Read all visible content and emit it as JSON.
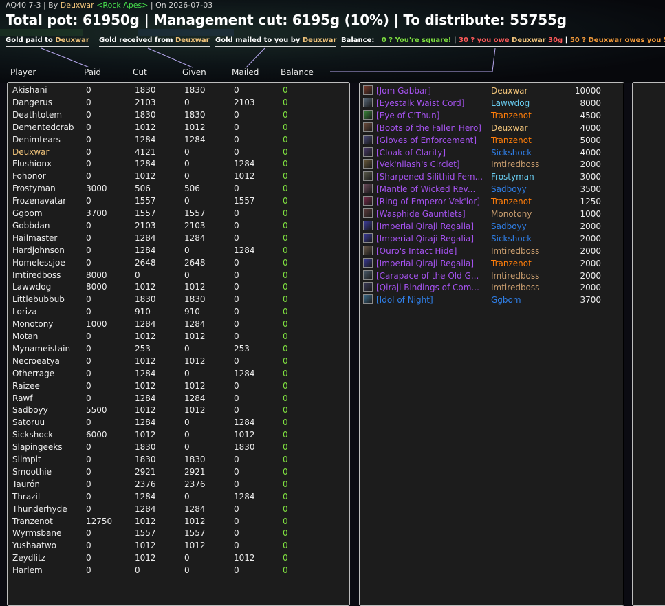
{
  "header": {
    "raid": "AQ40 7-3",
    "by_prefix": " | By ",
    "author": "Deuxwar",
    "guild": "<Rock Apes>",
    "date_text": " | On 2026-07-03",
    "title": "Total pot: 61950g | Management cut: 6195g (10%) | To distribute: 55755g"
  },
  "legends": {
    "paid": {
      "label": "Gold paid to ",
      "name": "Deuxwar"
    },
    "received": {
      "label": "Gold received from ",
      "name": "Deuxwar"
    },
    "mailed": {
      "label": "Gold mailed to you by ",
      "name": "Deuxwar"
    },
    "balance": {
      "label": "Balance:",
      "square": "0 ? You're square!",
      "sep1": " | ",
      "owe_prefix": "30 ? you owe ",
      "owe_name": "Deuxwar",
      "owe_amount": " 30g",
      "sep2": " | ",
      "owes_text": "50 ? Deuxwar owes you 50g"
    }
  },
  "columns": {
    "player": "Player",
    "paid": "Paid",
    "cut": "Cut",
    "given": "Given",
    "mailed": "Mailed",
    "balance": "Balance"
  },
  "colors": {
    "epic": "#a452ee",
    "rare": "#2f7fe8",
    "positive": "#7fe040",
    "rogue": "#f0c37a",
    "druid": "#ff7d0a",
    "shaman": "#2f7fe8",
    "mage": "#69ccf0",
    "warrior": "#c79c6e"
  },
  "players": [
    {
      "name": "Akishani",
      "paid": "0",
      "cut": "1830",
      "given": "1830",
      "mailed": "0",
      "balance": "0"
    },
    {
      "name": "Dangerus",
      "paid": "0",
      "cut": "2103",
      "given": "0",
      "mailed": "2103",
      "balance": "0"
    },
    {
      "name": "Deathtotem",
      "paid": "0",
      "cut": "1830",
      "given": "1830",
      "mailed": "0",
      "balance": "0"
    },
    {
      "name": "Dementedcrab",
      "paid": "0",
      "cut": "1012",
      "given": "1012",
      "mailed": "0",
      "balance": "0"
    },
    {
      "name": "Denimtears",
      "paid": "0",
      "cut": "1284",
      "given": "1284",
      "mailed": "0",
      "balance": "0"
    },
    {
      "name": "Deuxwar",
      "paid": "0",
      "cut": "4121",
      "given": "0",
      "mailed": "0",
      "balance": "0",
      "highlight": true
    },
    {
      "name": "Flushionx",
      "paid": "0",
      "cut": "1284",
      "given": "0",
      "mailed": "1284",
      "balance": "0"
    },
    {
      "name": "Fohonor",
      "paid": "0",
      "cut": "1012",
      "given": "0",
      "mailed": "1012",
      "balance": "0"
    },
    {
      "name": "Frostyman",
      "paid": "3000",
      "cut": "506",
      "given": "506",
      "mailed": "0",
      "balance": "0"
    },
    {
      "name": "Frozenavatar",
      "paid": "0",
      "cut": "1557",
      "given": "0",
      "mailed": "1557",
      "balance": "0"
    },
    {
      "name": "Ggbom",
      "paid": "3700",
      "cut": "1557",
      "given": "1557",
      "mailed": "0",
      "balance": "0"
    },
    {
      "name": "Gobbdan",
      "paid": "0",
      "cut": "2103",
      "given": "2103",
      "mailed": "0",
      "balance": "0"
    },
    {
      "name": "Hailmaster",
      "paid": "0",
      "cut": "1284",
      "given": "1284",
      "mailed": "0",
      "balance": "0"
    },
    {
      "name": "Hardjohnson",
      "paid": "0",
      "cut": "1284",
      "given": "0",
      "mailed": "1284",
      "balance": "0"
    },
    {
      "name": "Homelessjoe",
      "paid": "0",
      "cut": "2648",
      "given": "2648",
      "mailed": "0",
      "balance": "0"
    },
    {
      "name": "Imtiredboss",
      "paid": "8000",
      "cut": "0",
      "given": "0",
      "mailed": "0",
      "balance": "0"
    },
    {
      "name": "Lawwdog",
      "paid": "8000",
      "cut": "1012",
      "given": "1012",
      "mailed": "0",
      "balance": "0"
    },
    {
      "name": "Littlebubbub",
      "paid": "0",
      "cut": "1830",
      "given": "1830",
      "mailed": "0",
      "balance": "0"
    },
    {
      "name": "Loriza",
      "paid": "0",
      "cut": "910",
      "given": "910",
      "mailed": "0",
      "balance": "0"
    },
    {
      "name": "Monotony",
      "paid": "1000",
      "cut": "1284",
      "given": "1284",
      "mailed": "0",
      "balance": "0"
    },
    {
      "name": "Motan",
      "paid": "0",
      "cut": "1012",
      "given": "1012",
      "mailed": "0",
      "balance": "0"
    },
    {
      "name": "Mynameistain",
      "paid": "0",
      "cut": "253",
      "given": "0",
      "mailed": "253",
      "balance": "0"
    },
    {
      "name": "Necroeatya",
      "paid": "0",
      "cut": "1012",
      "given": "1012",
      "mailed": "0",
      "balance": "0"
    },
    {
      "name": "Otherrage",
      "paid": "0",
      "cut": "1284",
      "given": "0",
      "mailed": "1284",
      "balance": "0"
    },
    {
      "name": "Raizee",
      "paid": "0",
      "cut": "1012",
      "given": "1012",
      "mailed": "0",
      "balance": "0"
    },
    {
      "name": "Rawf",
      "paid": "0",
      "cut": "1284",
      "given": "1284",
      "mailed": "0",
      "balance": "0"
    },
    {
      "name": "Sadboyy",
      "paid": "5500",
      "cut": "1012",
      "given": "1012",
      "mailed": "0",
      "balance": "0"
    },
    {
      "name": "Satoruu",
      "paid": "0",
      "cut": "1284",
      "given": "0",
      "mailed": "1284",
      "balance": "0"
    },
    {
      "name": "Sickshock",
      "paid": "6000",
      "cut": "1012",
      "given": "0",
      "mailed": "1012",
      "balance": "0"
    },
    {
      "name": "Slapingeeks",
      "paid": "0",
      "cut": "1830",
      "given": "0",
      "mailed": "1830",
      "balance": "0"
    },
    {
      "name": "Slimpit",
      "paid": "0",
      "cut": "1830",
      "given": "1830",
      "mailed": "0",
      "balance": "0"
    },
    {
      "name": "Smoothie",
      "paid": "0",
      "cut": "2921",
      "given": "2921",
      "mailed": "0",
      "balance": "0"
    },
    {
      "name": "Taurón",
      "paid": "0",
      "cut": "2376",
      "given": "2376",
      "mailed": "0",
      "balance": "0"
    },
    {
      "name": "Thrazil",
      "paid": "0",
      "cut": "1284",
      "given": "0",
      "mailed": "1284",
      "balance": "0"
    },
    {
      "name": "Thunderhyde",
      "paid": "0",
      "cut": "1284",
      "given": "1284",
      "mailed": "0",
      "balance": "0"
    },
    {
      "name": "Tranzenot",
      "paid": "12750",
      "cut": "1012",
      "given": "1012",
      "mailed": "0",
      "balance": "0"
    },
    {
      "name": "Wyrmsbane",
      "paid": "0",
      "cut": "1557",
      "given": "1557",
      "mailed": "0",
      "balance": "0"
    },
    {
      "name": "Yushaatwo",
      "paid": "0",
      "cut": "1012",
      "given": "1012",
      "mailed": "0",
      "balance": "0"
    },
    {
      "name": "Zeydlitz",
      "paid": "0",
      "cut": "1012",
      "given": "0",
      "mailed": "1012",
      "balance": "0"
    },
    {
      "name": "Harlem",
      "paid": "0",
      "cut": "0",
      "given": "0",
      "mailed": "0",
      "balance": "0"
    }
  ],
  "items": [
    {
      "item": "[Jom Gabbar]",
      "rarity": "epic",
      "icon": "trinket-icon",
      "icon_color": "#7a3a2a",
      "winner": "Deuxwar",
      "winner_color": "#f0c37a",
      "price": "10000"
    },
    {
      "item": "[Eyestalk Waist Cord]",
      "rarity": "epic",
      "icon": "belt-icon",
      "icon_color": "#5a6a7a",
      "winner": "Lawwdog",
      "winner_color": "#69ccf0",
      "price": "8000"
    },
    {
      "item": "[Eye of C'Thun]",
      "rarity": "epic",
      "icon": "eye-icon",
      "icon_color": "#3a8a3a",
      "winner": "Tranzenot",
      "winner_color": "#ff7d0a",
      "price": "4500"
    },
    {
      "item": "[Boots of the Fallen Hero]",
      "rarity": "epic",
      "icon": "boots-icon",
      "icon_color": "#6a4a3a",
      "winner": "Deuxwar",
      "winner_color": "#f0c37a",
      "price": "4000"
    },
    {
      "item": "[Gloves of Enforcement]",
      "rarity": "epic",
      "icon": "gloves-icon",
      "icon_color": "#4a4a7a",
      "winner": "Tranzenot",
      "winner_color": "#ff7d0a",
      "price": "5000"
    },
    {
      "item": "[Cloak of Clarity]",
      "rarity": "epic",
      "icon": "cloak-icon",
      "icon_color": "#4a3a6a",
      "winner": "Sickshock",
      "winner_color": "#2f7fe8",
      "price": "4000"
    },
    {
      "item": "[Vek'nilash's Circlet]",
      "rarity": "epic",
      "icon": "helm-icon",
      "icon_color": "#6a5a3a",
      "winner": "Imtiredboss",
      "winner_color": "#c79c6e",
      "price": "2000"
    },
    {
      "item": "[Sharpened Silithid Fem...",
      "rarity": "epic",
      "icon": "dagger-icon",
      "icon_color": "#5a5a4a",
      "winner": "Frostyman",
      "winner_color": "#69ccf0",
      "price": "3000"
    },
    {
      "item": "[Mantle of Wicked Rev...",
      "rarity": "epic",
      "icon": "shoulder-icon",
      "icon_color": "#6a4a5a",
      "winner": "Sadboyy",
      "winner_color": "#2f7fe8",
      "price": "3500"
    },
    {
      "item": "[Ring of Emperor Vek'lor]",
      "rarity": "epic",
      "icon": "ring-icon",
      "icon_color": "#7a2a4a",
      "winner": "Tranzenot",
      "winner_color": "#ff7d0a",
      "price": "1250"
    },
    {
      "item": "[Wasphide Gauntlets]",
      "rarity": "epic",
      "icon": "gauntlets-icon",
      "icon_color": "#5a3a3a",
      "winner": "Monotony",
      "winner_color": "#c79c6e",
      "price": "1000"
    },
    {
      "item": "[Imperial Qiraji Regalia]",
      "rarity": "epic",
      "icon": "regalia-icon",
      "icon_color": "#3a3a9a",
      "winner": "Sadboyy",
      "winner_color": "#2f7fe8",
      "price": "2000"
    },
    {
      "item": "[Imperial Qiraji Regalia]",
      "rarity": "epic",
      "icon": "regalia-icon",
      "icon_color": "#3a3a9a",
      "winner": "Sickshock",
      "winner_color": "#2f7fe8",
      "price": "2000"
    },
    {
      "item": "[Ouro's Intact Hide]",
      "rarity": "epic",
      "icon": "hide-icon",
      "icon_color": "#6a5a4a",
      "winner": "Imtiredboss",
      "winner_color": "#c79c6e",
      "price": "2000"
    },
    {
      "item": "[Imperial Qiraji Regalia]",
      "rarity": "epic",
      "icon": "regalia-icon",
      "icon_color": "#3a3a9a",
      "winner": "Tranzenot",
      "winner_color": "#ff7d0a",
      "price": "2000"
    },
    {
      "item": "[Carapace of the Old G...",
      "rarity": "epic",
      "icon": "carapace-icon",
      "icon_color": "#4a5a6a",
      "winner": "Imtiredboss",
      "winner_color": "#c79c6e",
      "price": "2000"
    },
    {
      "item": "[Qiraji Bindings of Com...",
      "rarity": "epic",
      "icon": "bindings-icon",
      "icon_color": "#3a3a5a",
      "winner": "Imtiredboss",
      "winner_color": "#c79c6e",
      "price": "2000"
    },
    {
      "item": "[Idol of Night]",
      "rarity": "rare",
      "icon": "idol-icon",
      "icon_color": "#3a6a8a",
      "winner": "Ggbom",
      "winner_color": "#2f7fe8",
      "price": "3700"
    }
  ]
}
